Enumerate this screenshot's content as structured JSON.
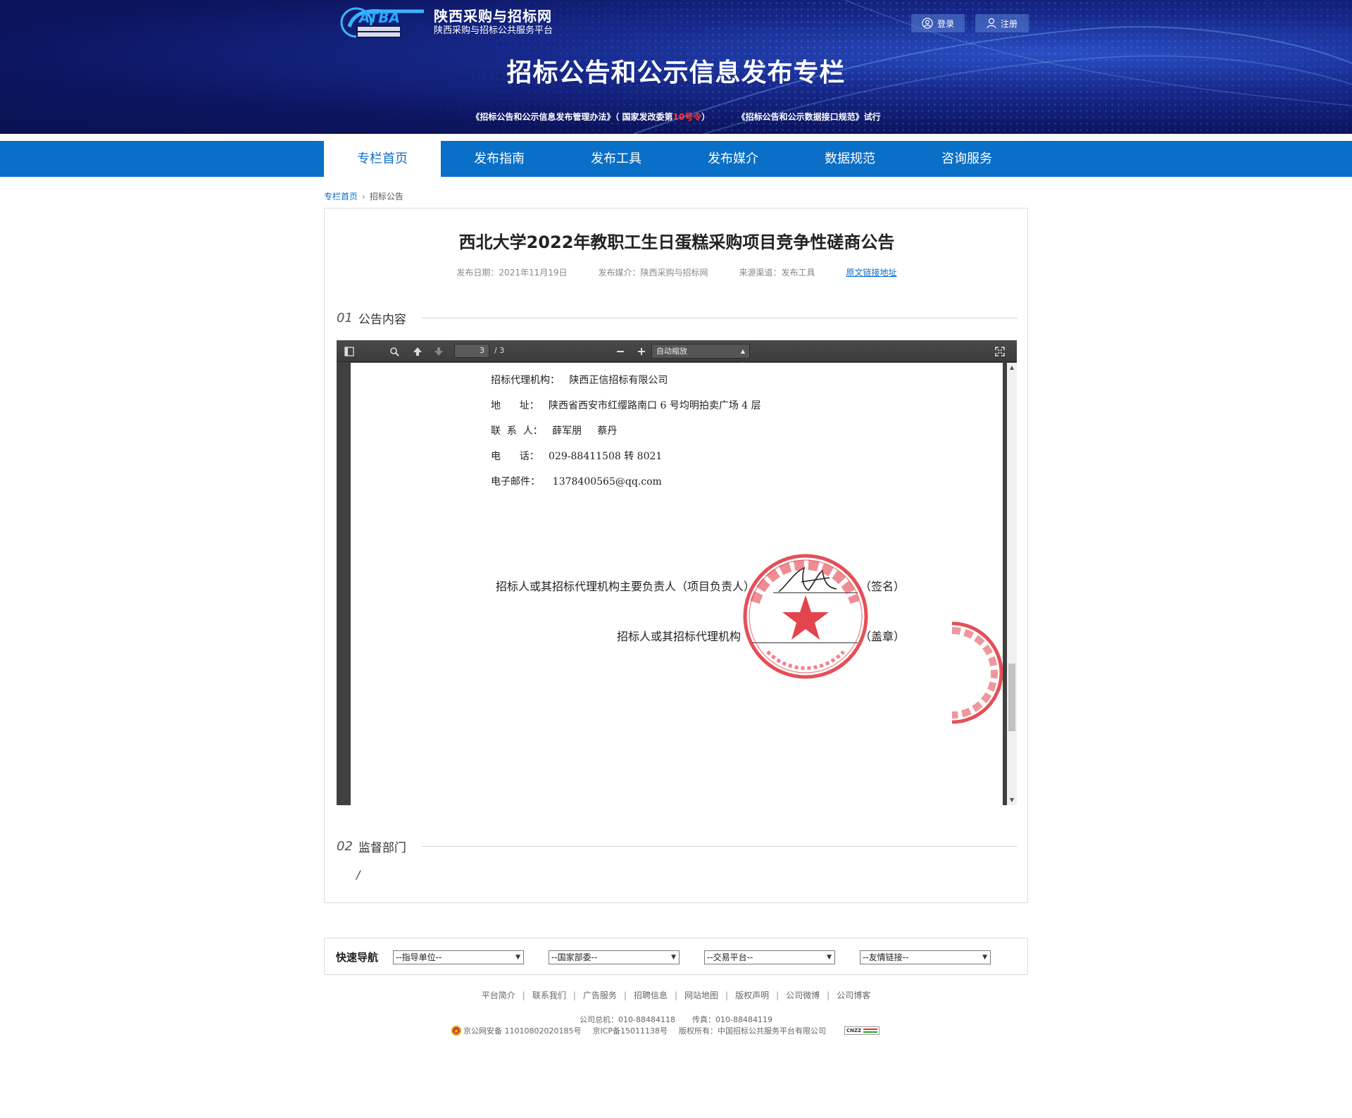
{
  "header": {
    "logo_name": "陕西采购与招标网",
    "logo_sub": "陕西采购与招标公共服务平台",
    "login": "登录",
    "register": "注册",
    "title": "招标公告和公示信息发布专栏",
    "notice_part1": "《招标公告和公示信息发布管理办法》（ 国家发改委第",
    "notice_red": "10号令",
    "notice_part2": "）",
    "notice_part3": "《招标公告和公示数据接口规范》试行"
  },
  "nav": {
    "items": [
      "专栏首页",
      "发布指南",
      "发布工具",
      "发布媒介",
      "数据规范",
      "咨询服务"
    ],
    "active_index": 0
  },
  "breadcrumb": {
    "home": "专栏首页",
    "current": "招标公告"
  },
  "article": {
    "title": "西北大学2022年教职工生日蛋糕采购项目竞争性磋商公告",
    "date": "发布日期：2021年11月19日",
    "media": "发布媒介：陕西采购与招标网",
    "channel": "来源渠道：发布工具",
    "source_link": "原文链接地址"
  },
  "sections": {
    "s1_num": "01",
    "s1_label": "公告内容",
    "s2_num": "02",
    "s2_label": "监督部门",
    "s2_content": "/"
  },
  "pdf": {
    "page": "3",
    "total": "/ 3",
    "zoom": "自动缩放",
    "lines": [
      "招标代理机构：   陕西正信招标有限公司",
      "地      址：   陕西省西安市红缨路南口 6 号均明拍卖广场 4 层",
      "联  系  人：   薛军朋     蔡丹",
      "电      话：   029-88411508 转 8021",
      "电子邮件：    1378400565@qq.com"
    ],
    "sign1_label": "招标人或其招标代理机构主要负责人（项目负责人）",
    "sign1_suffix": "（签名）",
    "sign2_label": "招标人或其招标代理机构",
    "sign2_suffix": "（盖章）"
  },
  "quick_nav": {
    "title": "快速导航",
    "selects": [
      "--指导单位--",
      "--国家部委--",
      "--交易平台--",
      "--友情链接--"
    ]
  },
  "footer": {
    "links": [
      "平台简介",
      "联系我们",
      "广告服务",
      "招聘信息",
      "网站地图",
      "版权声明",
      "公司微博",
      "公司博客"
    ],
    "phone": "公司总机：010-88484118",
    "fax": "传真：010-88484119",
    "police": "京公网安备 11010802020185号",
    "icp": "京ICP备15011138号",
    "copyright": "版权所有：中国招标公共服务平台有限公司",
    "badge": "CNZZ"
  },
  "colors": {
    "nav_blue": "#0a6fc7",
    "banner_dark": "#0c1560",
    "notice_red": "#ff3a3a",
    "stamp_red": "#e0303a"
  }
}
